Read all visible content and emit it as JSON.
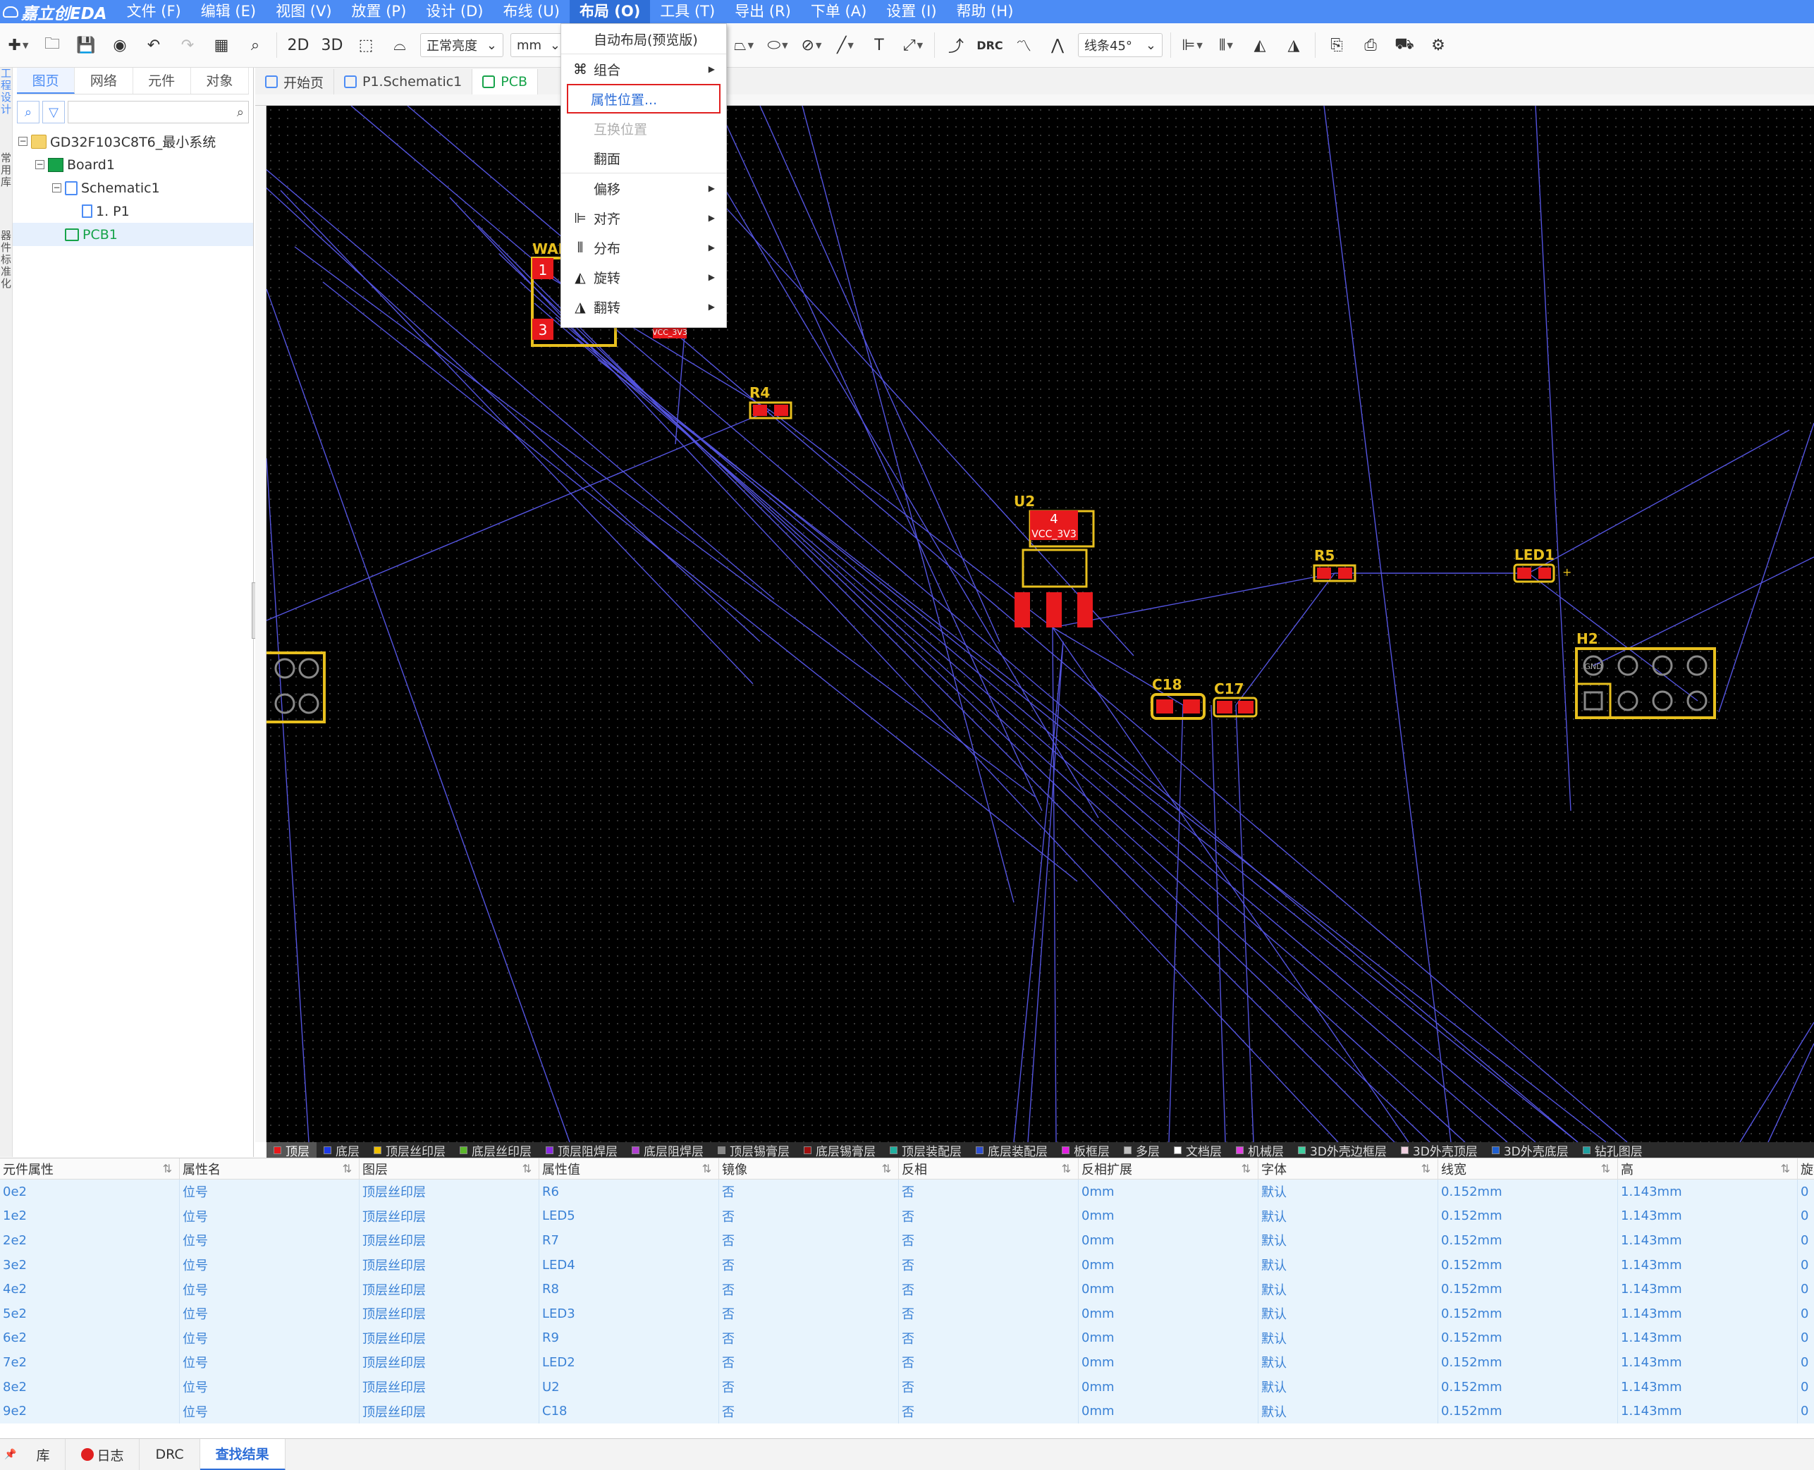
{
  "app": {
    "logo": "嘉立创EDA"
  },
  "menubar": [
    {
      "label": "文件 (F)"
    },
    {
      "label": "编辑 (E)"
    },
    {
      "label": "视图 (V)"
    },
    {
      "label": "放置 (P)"
    },
    {
      "label": "设计 (D)"
    },
    {
      "label": "布线 (U)"
    },
    {
      "label": "布局 (O)"
    },
    {
      "label": "工具 (T)"
    },
    {
      "label": "导出 (R)"
    },
    {
      "label": "下单 (A)"
    },
    {
      "label": "设置 (I)"
    },
    {
      "label": "帮助 (H)"
    }
  ],
  "toolbar": {
    "view2d": "2D",
    "view3d": "3D",
    "brightness": "正常亮度",
    "unit": "mm",
    "drc": "DRC",
    "line_angle": "线条45°"
  },
  "left_rail": [
    "工程设计",
    "常用库",
    "器件标准化"
  ],
  "left_panel": {
    "tabs": [
      "图页",
      "网络",
      "元件",
      "对象"
    ],
    "tree": [
      {
        "label": "GD32F103C8T6_最小系统",
        "icon": "folder-icon",
        "level": 0
      },
      {
        "label": "Board1",
        "icon": "board-icon",
        "level": 1
      },
      {
        "label": "Schematic1",
        "icon": "schematic-icon",
        "level": 2
      },
      {
        "label": "1. P1",
        "icon": "page-icon",
        "level": 3
      },
      {
        "label": "PCB1",
        "icon": "pcb-icon",
        "level": 2
      }
    ]
  },
  "doc_tabs": [
    {
      "label": "开始页",
      "icon": "home-cloud-icon"
    },
    {
      "label": "P1.Schematic1",
      "icon": "page-icon"
    },
    {
      "label": "PCB",
      "icon": "pcb-icon"
    }
  ],
  "layout_menu": {
    "items": [
      {
        "label": "自动布局(预览版)",
        "icon": "",
        "submenu": false,
        "state": "normal"
      },
      {
        "label": "组合",
        "icon": "group-icon",
        "submenu": true,
        "state": "normal"
      },
      {
        "label": "属性位置...",
        "icon": "",
        "submenu": false,
        "state": "highlighted"
      },
      {
        "label": "互换位置",
        "icon": "",
        "submenu": false,
        "state": "disabled"
      },
      {
        "label": "翻面",
        "icon": "",
        "submenu": false,
        "state": "normal"
      },
      {
        "label": "偏移",
        "icon": "",
        "submenu": true,
        "state": "normal"
      },
      {
        "label": "对齐",
        "icon": "align-icon",
        "submenu": true,
        "state": "normal"
      },
      {
        "label": "分布",
        "icon": "distribute-icon",
        "submenu": true,
        "state": "normal"
      },
      {
        "label": "旋转",
        "icon": "rotate-icon",
        "submenu": true,
        "state": "normal"
      },
      {
        "label": "翻转",
        "icon": "flip-icon",
        "submenu": true,
        "state": "normal"
      }
    ]
  },
  "pcb": {
    "colors": {
      "pad": "#e8191c",
      "silk": "#e8c01e",
      "ratsnest": "#5454e0",
      "board_bg": "#000000"
    },
    "designators": [
      "R4",
      "U2",
      "R5",
      "LED1",
      "C18",
      "C17",
      "H2",
      "WAK"
    ],
    "pad_labels": [
      "1",
      "3",
      "4",
      "VCC_3V3",
      "VCC_3V3",
      "GND",
      "+"
    ]
  },
  "layers": [
    {
      "label": "顶层",
      "color": "#e8191c",
      "active": true
    },
    {
      "label": "底层",
      "color": "#1e3be8"
    },
    {
      "label": "顶层丝印层",
      "color": "#f0c000"
    },
    {
      "label": "底层丝印层",
      "color": "#5cb82c"
    },
    {
      "label": "顶层阻焊层",
      "color": "#8a2be2"
    },
    {
      "label": "底层阻焊层",
      "color": "#b040d0"
    },
    {
      "label": "顶层锡膏层",
      "color": "#888888"
    },
    {
      "label": "底层锡膏层",
      "color": "#a01010"
    },
    {
      "label": "顶层装配层",
      "color": "#20b0a0"
    },
    {
      "label": "底层装配层",
      "color": "#3050d0"
    },
    {
      "label": "板框层",
      "color": "#e020e0"
    },
    {
      "label": "多层",
      "color": "#c0c0c0"
    },
    {
      "label": "文档层",
      "color": "#ffffff"
    },
    {
      "label": "机械层",
      "color": "#e040e0"
    },
    {
      "label": "3D外壳边框层",
      "color": "#40d0a0"
    },
    {
      "label": "3D外壳顶层",
      "color": "#f0d0e0"
    },
    {
      "label": "3D外壳底层",
      "color": "#2060d0"
    },
    {
      "label": "钻孔图层",
      "color": "#20a0a0"
    }
  ],
  "table": {
    "columns": [
      "元件属性",
      "属性名",
      "图层",
      "属性值",
      "镜像",
      "反相",
      "反相扩展",
      "字体",
      "线宽",
      "高",
      "旋转"
    ],
    "rows": [
      [
        "0e2",
        "位号",
        "顶层丝印层",
        "R6",
        "否",
        "否",
        "0mm",
        "默认",
        "0.152mm",
        "1.143mm",
        "0"
      ],
      [
        "1e2",
        "位号",
        "顶层丝印层",
        "LED5",
        "否",
        "否",
        "0mm",
        "默认",
        "0.152mm",
        "1.143mm",
        "0"
      ],
      [
        "2e2",
        "位号",
        "顶层丝印层",
        "R7",
        "否",
        "否",
        "0mm",
        "默认",
        "0.152mm",
        "1.143mm",
        "0"
      ],
      [
        "3e2",
        "位号",
        "顶层丝印层",
        "LED4",
        "否",
        "否",
        "0mm",
        "默认",
        "0.152mm",
        "1.143mm",
        "0"
      ],
      [
        "4e2",
        "位号",
        "顶层丝印层",
        "R8",
        "否",
        "否",
        "0mm",
        "默认",
        "0.152mm",
        "1.143mm",
        "0"
      ],
      [
        "5e2",
        "位号",
        "顶层丝印层",
        "LED3",
        "否",
        "否",
        "0mm",
        "默认",
        "0.152mm",
        "1.143mm",
        "0"
      ],
      [
        "6e2",
        "位号",
        "顶层丝印层",
        "R9",
        "否",
        "否",
        "0mm",
        "默认",
        "0.152mm",
        "1.143mm",
        "0"
      ],
      [
        "7e2",
        "位号",
        "顶层丝印层",
        "LED2",
        "否",
        "否",
        "0mm",
        "默认",
        "0.152mm",
        "1.143mm",
        "0"
      ],
      [
        "8e2",
        "位号",
        "顶层丝印层",
        "U2",
        "否",
        "否",
        "0mm",
        "默认",
        "0.152mm",
        "1.143mm",
        "0"
      ],
      [
        "9e2",
        "位号",
        "顶层丝印层",
        "C18",
        "否",
        "否",
        "0mm",
        "默认",
        "0.152mm",
        "1.143mm",
        "0"
      ]
    ]
  },
  "status_tabs": [
    {
      "label": "库"
    },
    {
      "label": "日志"
    },
    {
      "label": "DRC"
    },
    {
      "label": "查找结果",
      "active": true
    }
  ]
}
